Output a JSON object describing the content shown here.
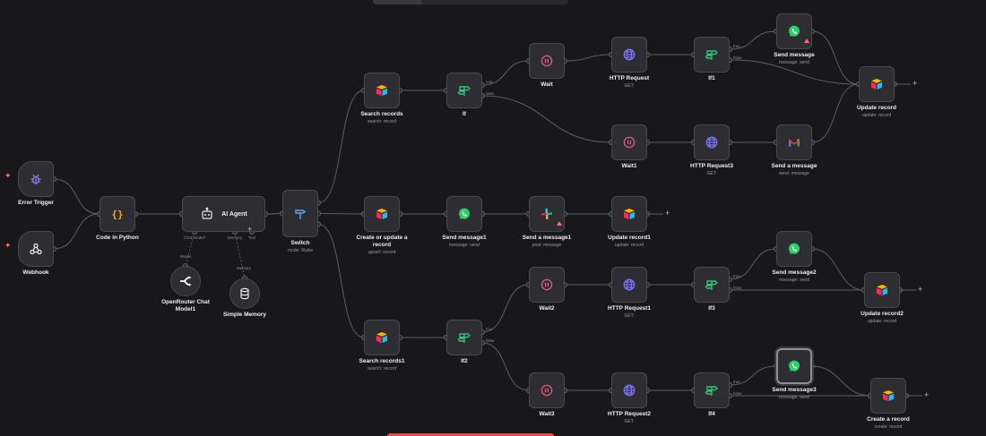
{
  "nodes": {
    "error_trigger": {
      "label": "Error Trigger",
      "sub": ""
    },
    "webhook": {
      "label": "Webhook",
      "sub": ""
    },
    "code_python": {
      "label": "Code in Python",
      "sub": ""
    },
    "ai_agent": {
      "label": "AI Agent",
      "sub": ""
    },
    "openrouter": {
      "label": "OpenRouter Chat Model1",
      "sub": ""
    },
    "simple_memory": {
      "label": "Simple Memory",
      "sub": ""
    },
    "switch": {
      "label": "Switch",
      "sub": "mode: Rules"
    },
    "search_records": {
      "label": "Search records",
      "sub": "search: record"
    },
    "if": {
      "label": "If",
      "sub": ""
    },
    "wait": {
      "label": "Wait",
      "sub": ""
    },
    "http_request": {
      "label": "HTTP Request",
      "sub": "GET:"
    },
    "if1": {
      "label": "If1",
      "sub": ""
    },
    "send_message": {
      "label": "Send message",
      "sub": "message: send"
    },
    "update_record": {
      "label": "Update record",
      "sub": "update: record"
    },
    "wait1": {
      "label": "Wait1",
      "sub": ""
    },
    "http_request3": {
      "label": "HTTP Request3",
      "sub": "GET:"
    },
    "send_a_message": {
      "label": "Send a message",
      "sub": "send: message"
    },
    "create_update": {
      "label": "Create or update a record",
      "sub": "upsert: record"
    },
    "send_message1": {
      "label": "Send message1",
      "sub": "message: send"
    },
    "send_a_message1": {
      "label": "Send a message1",
      "sub": "post: message"
    },
    "update_record1": {
      "label": "Update record1",
      "sub": "update: record"
    },
    "send_message2": {
      "label": "Send message2",
      "sub": "message: send"
    },
    "wait2": {
      "label": "Wait2",
      "sub": ""
    },
    "http_request1": {
      "label": "HTTP Request1",
      "sub": "GET:"
    },
    "if3": {
      "label": "If3",
      "sub": ""
    },
    "update_record2": {
      "label": "Update record2",
      "sub": "update: record"
    },
    "search_records1": {
      "label": "Search records1",
      "sub": "search: record"
    },
    "if2": {
      "label": "If2",
      "sub": ""
    },
    "wait3": {
      "label": "Wait3",
      "sub": ""
    },
    "http_request2": {
      "label": "HTTP Request2",
      "sub": "GET:"
    },
    "if4": {
      "label": "If4",
      "sub": ""
    },
    "send_message3": {
      "label": "Send message3",
      "sub": "message: send"
    },
    "create_record": {
      "label": "Create a record",
      "sub": "create: record"
    }
  },
  "ports": {
    "true_label": "true",
    "false_label": "false",
    "chat_model": "Chat Model*",
    "memory": "Memory",
    "tool": "Tool",
    "model_label": "Model",
    "memory_label": "Memory"
  },
  "colors": {
    "canvas_bg": "#18171a",
    "node_bg": "#2e2d31",
    "wire": "#5e5d63",
    "airtable_yellow": "#fcb400",
    "airtable_red": "#f82b60",
    "airtable_blue": "#18bfff",
    "whatsapp_green": "#25d366",
    "if_green": "#35c07a",
    "wait_pink": "#e05c7e",
    "http_purple": "#7a73ff",
    "code_orange": "#f5a623",
    "error_purple": "#8f7cf0",
    "switch_blue": "#5aa9f0",
    "warning_red": "#ff6d6d"
  },
  "icons": {
    "error_trigger": "bug-icon",
    "webhook": "webhook-icon",
    "code_python": "code-braces-icon",
    "ai_agent": "robot-icon",
    "openrouter": "openrouter-icon",
    "simple_memory": "database-icon",
    "switch": "switch-icon",
    "airtable": "airtable-icon",
    "if": "if-signpost-icon",
    "wait": "pause-circle-icon",
    "http": "globe-icon",
    "whatsapp": "whatsapp-icon",
    "gmail": "gmail-icon",
    "slack": "slack-icon"
  }
}
